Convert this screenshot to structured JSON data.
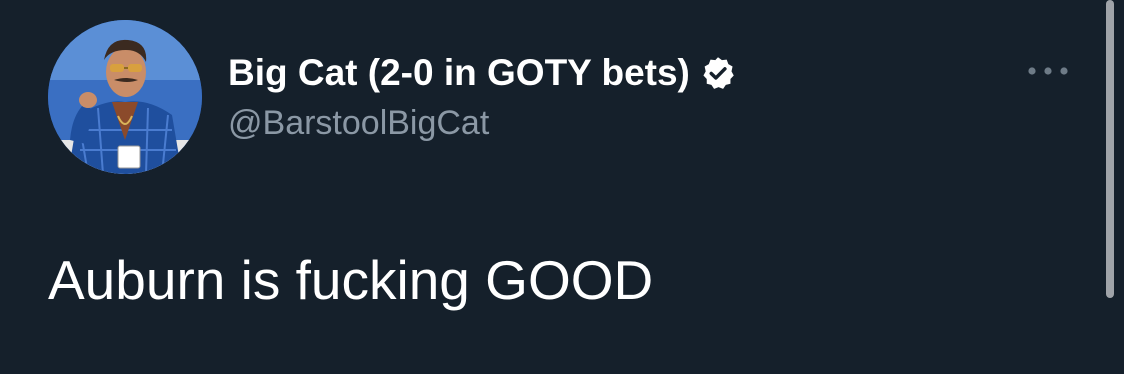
{
  "tweet": {
    "display_name": "Big Cat (2-0 in GOTY bets)",
    "handle": "@BarstoolBigCat",
    "text": "Auburn is fucking GOOD",
    "verified": true
  },
  "icons": {
    "verified": "verified-badge-icon",
    "more": "more-options-icon"
  },
  "colors": {
    "background": "#15202b",
    "name": "#ffffff",
    "handle": "#8b98a5",
    "text": "#ffffff"
  }
}
